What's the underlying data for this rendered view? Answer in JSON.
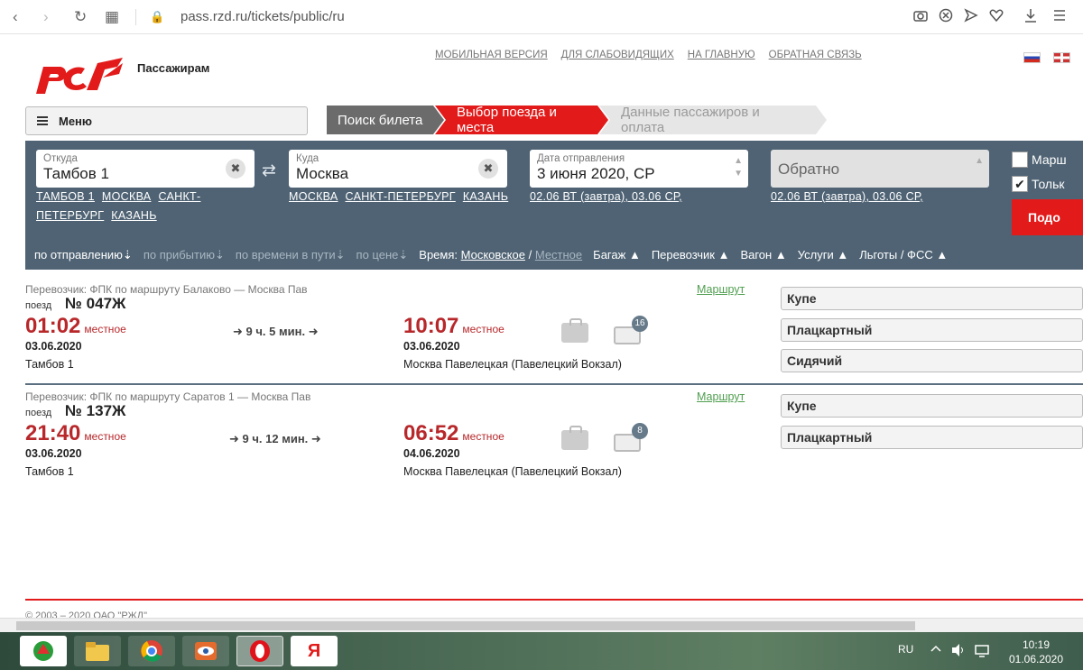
{
  "browser": {
    "url": "pass.rzd.ru/tickets/public/ru",
    "nav_back": "‹",
    "nav_forward": "›",
    "reload": "↻",
    "tabs_grid": "▦",
    "lock": "🔒"
  },
  "header": {
    "brand": "Пассажирам",
    "top_links": [
      "МОБИЛЬНАЯ ВЕРСИЯ",
      "ДЛЯ СЛАБОВИДЯЩИХ",
      "НА ГЛАВНУЮ",
      "ОБРАТНАЯ СВЯЗЬ"
    ],
    "menu_label": "Меню"
  },
  "steps": [
    "Поиск билета",
    "Выбор поезда и места",
    "Данные пассажиров и оплата"
  ],
  "search": {
    "from_label": "Откуда",
    "from_value": "Тамбов 1",
    "from_quick": [
      "ТАМБОВ 1",
      "МОСКВА",
      "САНКТ-ПЕТЕРБУРГ",
      "КАЗАНЬ"
    ],
    "to_label": "Куда",
    "to_value": "Москва",
    "to_quick": [
      "МОСКВА",
      "САНКТ-ПЕТЕРБУРГ",
      "КАЗАНЬ"
    ],
    "date_label": "Дата отправления",
    "date_value": "3 июня 2020, СР",
    "date_quick": "02.06 ВТ (завтра), 03.06 СР,",
    "back_value": "Обратно",
    "back_quick": "02.06 ВТ (завтра), 03.06 СР,",
    "check_route": "Марш",
    "check_only": "Тольк",
    "search_button": "Подо"
  },
  "sortbar": {
    "by_departure": "по отправлению",
    "by_arrival": "по прибытию",
    "by_travel_time": "по времени в пути",
    "by_price": "по цене",
    "time_label": "Время:",
    "time_moscow": "Московское",
    "time_slash": "/",
    "time_local": "Местное",
    "baggage": "Багаж",
    "carrier": "Перевозчик",
    "wagon": "Вагон",
    "services": "Услуги",
    "benefits": "Льготы / ФСС"
  },
  "trains": [
    {
      "carrier": "Перевозчик: ФПК    по маршруту Балаково — Москва Пав",
      "route_link": "Маршрут",
      "train_word": "поезд",
      "number": "№ 047Ж",
      "dep_time": "01:02",
      "dep_local": "местное",
      "dep_date": "03.06.2020",
      "dep_station": "Тамбов 1",
      "duration": "9 ч. 5 мин.",
      "arr_time": "10:07",
      "arr_local": "местное",
      "arr_date": "03.06.2020",
      "arr_station": "Москва Павелецкая (Павелецкий Вокзал)",
      "wagons_count": "16",
      "classes": [
        "Купе",
        "Плацкартный",
        "Сидячий"
      ]
    },
    {
      "carrier": "Перевозчик: ФПК    по маршруту Саратов 1 — Москва Пав",
      "route_link": "Маршрут",
      "train_word": "поезд",
      "number": "№ 137Ж",
      "dep_time": "21:40",
      "dep_local": "местное",
      "dep_date": "03.06.2020",
      "dep_station": "Тамбов 1",
      "duration": "9 ч. 12 мин.",
      "arr_time": "06:52",
      "arr_local": "местное",
      "arr_date": "04.06.2020",
      "arr_station": "Москва Павелецкая (Павелецкий Вокзал)",
      "wagons_count": "8",
      "classes": [
        "Купе",
        "Плацкартный"
      ]
    }
  ],
  "footer": {
    "copyright": "© 2003 – 2020  ОАО \"РЖД\""
  },
  "taskbar": {
    "lang": "RU",
    "time": "10:19",
    "date": "01.06.2020",
    "yandex_glyph": "Я"
  },
  "colors": {
    "brand_red": "#e21a1a",
    "panel": "#4f6374",
    "time_red": "#b8282b"
  }
}
